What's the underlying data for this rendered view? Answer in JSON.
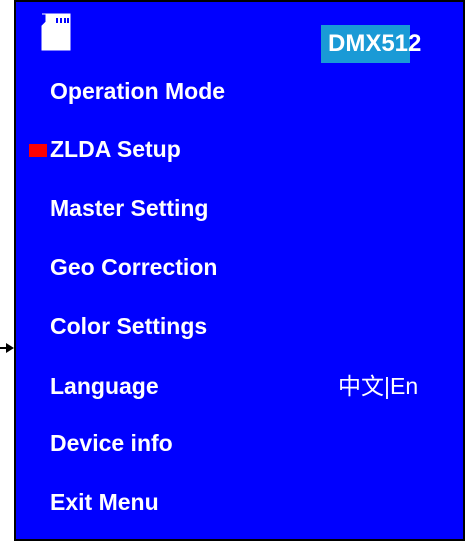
{
  "header": {
    "sd_card_icon": "sd-card-icon",
    "protocol_badge": "DMX512",
    "badge_color": "#1a9ad6"
  },
  "menu": {
    "background_color": "#0000ff",
    "selection_marker_color": "#ff0000",
    "selected_index": 1,
    "items": [
      {
        "label": "Operation Mode"
      },
      {
        "label": "ZLDA Setup"
      },
      {
        "label": "Master Setting"
      },
      {
        "label": "Geo Correction"
      },
      {
        "label": "Color Settings"
      },
      {
        "label": "Language",
        "value": "中文|En"
      },
      {
        "label": "Device info"
      },
      {
        "label": "Exit Menu"
      }
    ]
  }
}
